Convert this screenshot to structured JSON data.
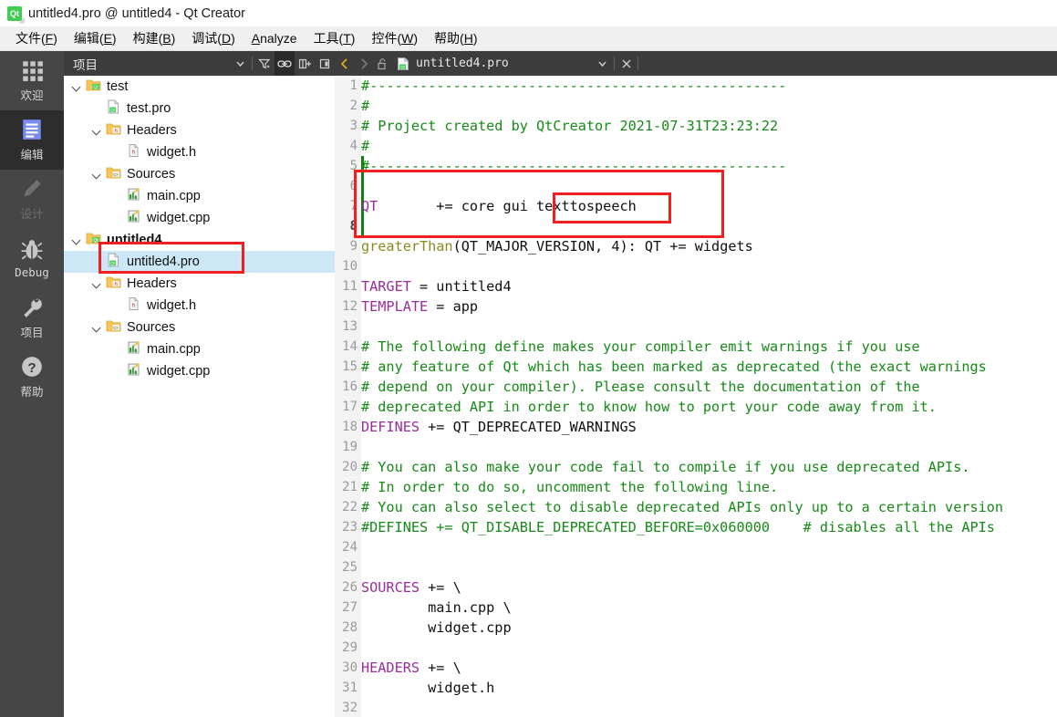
{
  "window": {
    "title": "untitled4.pro @ untitled4 - Qt Creator",
    "app_icon": "qt-logo-icon"
  },
  "menubar": {
    "items": [
      {
        "label": "文件(F)",
        "pre": "文件(",
        "acc": "F",
        "post": ")"
      },
      {
        "label": "编辑(E)",
        "pre": "编辑(",
        "acc": "E",
        "post": ")"
      },
      {
        "label": "构建(B)",
        "pre": "构建(",
        "acc": "B",
        "post": ")"
      },
      {
        "label": "调试(D)",
        "pre": "调试(",
        "acc": "D",
        "post": ")"
      },
      {
        "label": "Analyze",
        "pre": "",
        "acc": "A",
        "post": "nalyze"
      },
      {
        "label": "工具(T)",
        "pre": "工具(",
        "acc": "T",
        "post": ")"
      },
      {
        "label": "控件(W)",
        "pre": "控件(",
        "acc": "W",
        "post": ")"
      },
      {
        "label": "帮助(H)",
        "pre": "帮助(",
        "acc": "H",
        "post": ")"
      }
    ]
  },
  "mode_selector": {
    "items": [
      {
        "label": "欢迎",
        "icon": "grid-icon",
        "state": "normal"
      },
      {
        "label": "编辑",
        "icon": "document-lines-icon",
        "state": "selected"
      },
      {
        "label": "设计",
        "icon": "pencil-icon",
        "state": "disabled"
      },
      {
        "label": "Debug",
        "icon": "bug-icon",
        "state": "normal"
      },
      {
        "label": "项目",
        "icon": "wrench-icon",
        "state": "normal"
      },
      {
        "label": "帮助",
        "icon": "question-circle-icon",
        "state": "normal"
      }
    ]
  },
  "project_panel": {
    "title": "项目",
    "toolbar": [
      {
        "icon": "chevron-down-icon",
        "active": false
      },
      {
        "icon": "filter-icon",
        "active": false
      },
      {
        "icon": "link-sync-icon",
        "active": true
      },
      {
        "icon": "split-add-icon",
        "active": false
      },
      {
        "icon": "close-split-icon",
        "active": false
      }
    ],
    "tree": [
      {
        "label": "test",
        "indent": 0,
        "icon": "qt-folder-icon",
        "chevron": true,
        "bold": false,
        "selected": false
      },
      {
        "label": "test.pro",
        "indent": 1,
        "icon": "qt-pro-file-icon",
        "chevron": false,
        "bold": false,
        "selected": false
      },
      {
        "label": "Headers",
        "indent": 1,
        "icon": "h-folder-icon",
        "chevron": true,
        "bold": false,
        "selected": false
      },
      {
        "label": "widget.h",
        "indent": 2,
        "icon": "h-file-icon",
        "chevron": false,
        "bold": false,
        "selected": false
      },
      {
        "label": "Sources",
        "indent": 1,
        "icon": "cpp-folder-icon",
        "chevron": true,
        "bold": false,
        "selected": false
      },
      {
        "label": "main.cpp",
        "indent": 2,
        "icon": "cpp-file-icon",
        "chevron": false,
        "bold": false,
        "selected": false
      },
      {
        "label": "widget.cpp",
        "indent": 2,
        "icon": "cpp-file-icon",
        "chevron": false,
        "bold": false,
        "selected": false
      },
      {
        "label": "untitled4",
        "indent": 0,
        "icon": "qt-folder-icon",
        "chevron": true,
        "bold": true,
        "selected": false
      },
      {
        "label": "untitled4.pro",
        "indent": 1,
        "icon": "qt-pro-file-icon",
        "chevron": false,
        "bold": false,
        "selected": true
      },
      {
        "label": "Headers",
        "indent": 1,
        "icon": "h-folder-icon",
        "chevron": true,
        "bold": false,
        "selected": false
      },
      {
        "label": "widget.h",
        "indent": 2,
        "icon": "h-file-icon",
        "chevron": false,
        "bold": false,
        "selected": false
      },
      {
        "label": "Sources",
        "indent": 1,
        "icon": "cpp-folder-icon",
        "chevron": true,
        "bold": false,
        "selected": false
      },
      {
        "label": "main.cpp",
        "indent": 2,
        "icon": "cpp-file-icon",
        "chevron": false,
        "bold": false,
        "selected": false
      },
      {
        "label": "widget.cpp",
        "indent": 2,
        "icon": "cpp-file-icon",
        "chevron": false,
        "bold": false,
        "selected": false
      }
    ]
  },
  "editor_bar": {
    "back_icon": "chevron-left-icon",
    "forward_icon": "chevron-right-icon",
    "lock_icon": "unlock-icon",
    "file_icon": "qt-pro-file-icon",
    "filename": "untitled4.pro",
    "dropdown_icon": "chevron-down-icon",
    "close_icon": "close-icon"
  },
  "code": {
    "current_line": 8,
    "changed_lines": [
      5,
      6,
      7,
      8
    ],
    "lines": [
      {
        "n": 1,
        "spans": [
          {
            "t": "#--------------------------------------------------",
            "c": "cm"
          }
        ]
      },
      {
        "n": 2,
        "spans": [
          {
            "t": "#",
            "c": "cm"
          }
        ]
      },
      {
        "n": 3,
        "spans": [
          {
            "t": "# Project created by QtCreator 2021-07-31T23:23:22",
            "c": "cm"
          }
        ]
      },
      {
        "n": 4,
        "spans": [
          {
            "t": "#",
            "c": "cm"
          }
        ]
      },
      {
        "n": 5,
        "spans": [
          {
            "t": "#--------------------------------------------------",
            "c": "cm"
          }
        ]
      },
      {
        "n": 6,
        "spans": []
      },
      {
        "n": 7,
        "spans": [
          {
            "t": "QT",
            "c": "kw"
          },
          {
            "t": "       += core gui texttospeech",
            "c": "pl"
          }
        ]
      },
      {
        "n": 8,
        "spans": []
      },
      {
        "n": 9,
        "spans": [
          {
            "t": "greaterThan",
            "c": "fn"
          },
          {
            "t": "(QT_MAJOR_VERSION, 4): QT += widgets",
            "c": "pl"
          }
        ]
      },
      {
        "n": 10,
        "spans": []
      },
      {
        "n": 11,
        "spans": [
          {
            "t": "TARGET",
            "c": "kw"
          },
          {
            "t": " = untitled4",
            "c": "pl"
          }
        ]
      },
      {
        "n": 12,
        "spans": [
          {
            "t": "TEMPLATE",
            "c": "kw"
          },
          {
            "t": " = app",
            "c": "pl"
          }
        ]
      },
      {
        "n": 13,
        "spans": []
      },
      {
        "n": 14,
        "spans": [
          {
            "t": "# The following define makes your compiler emit warnings if you use",
            "c": "cm"
          }
        ]
      },
      {
        "n": 15,
        "spans": [
          {
            "t": "# any feature of Qt which has been marked as deprecated (the exact warnings",
            "c": "cm"
          }
        ]
      },
      {
        "n": 16,
        "spans": [
          {
            "t": "# depend on your compiler). Please consult the documentation of the",
            "c": "cm"
          }
        ]
      },
      {
        "n": 17,
        "spans": [
          {
            "t": "# deprecated API in order to know how to port your code away from it.",
            "c": "cm"
          }
        ]
      },
      {
        "n": 18,
        "spans": [
          {
            "t": "DEFINES",
            "c": "kw"
          },
          {
            "t": " += QT_DEPRECATED_WARNINGS",
            "c": "pl"
          }
        ]
      },
      {
        "n": 19,
        "spans": []
      },
      {
        "n": 20,
        "spans": [
          {
            "t": "# You can also make your code fail to compile if you use deprecated APIs.",
            "c": "cm"
          }
        ]
      },
      {
        "n": 21,
        "spans": [
          {
            "t": "# In order to do so, uncomment the following line.",
            "c": "cm"
          }
        ]
      },
      {
        "n": 22,
        "spans": [
          {
            "t": "# You can also select to disable deprecated APIs only up to a certain version",
            "c": "cm"
          }
        ]
      },
      {
        "n": 23,
        "spans": [
          {
            "t": "#DEFINES += QT_DISABLE_DEPRECATED_BEFORE=0x060000    # disables all the APIs",
            "c": "cm"
          }
        ]
      },
      {
        "n": 24,
        "spans": []
      },
      {
        "n": 25,
        "spans": []
      },
      {
        "n": 26,
        "spans": [
          {
            "t": "SOURCES",
            "c": "kw"
          },
          {
            "t": " += \\",
            "c": "pl"
          }
        ]
      },
      {
        "n": 27,
        "spans": [
          {
            "t": "        main.cpp \\",
            "c": "pl"
          }
        ]
      },
      {
        "n": 28,
        "spans": [
          {
            "t": "        widget.cpp",
            "c": "pl"
          }
        ]
      },
      {
        "n": 29,
        "spans": []
      },
      {
        "n": 30,
        "spans": [
          {
            "t": "HEADERS",
            "c": "kw"
          },
          {
            "t": " += \\",
            "c": "pl"
          }
        ]
      },
      {
        "n": 31,
        "spans": [
          {
            "t": "        widget.h",
            "c": "pl"
          }
        ]
      },
      {
        "n": 32,
        "spans": []
      }
    ]
  },
  "annotations": [
    {
      "name": "tree-highlight-rect",
      "target": "untitled4.pro",
      "color": "#f02020"
    },
    {
      "name": "code-block-rect",
      "target": "lines 5-8",
      "color": "#f02020"
    },
    {
      "name": "code-word-rect",
      "target": "texttospeech",
      "color": "#f02020"
    }
  ],
  "colors": {
    "comment": "#168a16",
    "keyword": "#9b2d9b",
    "function": "#8a8a23",
    "annotation": "#f02020",
    "selection": "#cce8f7",
    "chrome_dark": "#3c3c3c",
    "rail_dark": "#464646"
  }
}
